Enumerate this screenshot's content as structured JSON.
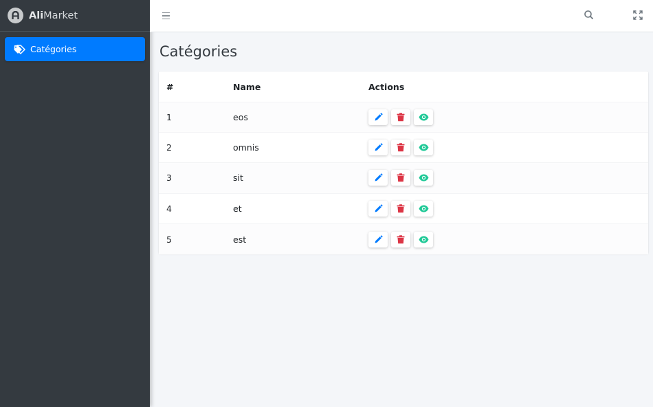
{
  "brand": {
    "name_bold": "Ali",
    "name_rest": "Market"
  },
  "sidebar": {
    "items": [
      {
        "label": "Catégories",
        "icon": "tags-icon",
        "active": true
      }
    ]
  },
  "topbar": {
    "menu_icon": "hamburger-icon",
    "search_icon": "search-icon",
    "fullscreen_icon": "expand-icon"
  },
  "page": {
    "title": "Catégories"
  },
  "table": {
    "headers": [
      "#",
      "Name",
      "Actions"
    ],
    "rows": [
      {
        "id": "1",
        "name": "eos"
      },
      {
        "id": "2",
        "name": "omnis"
      },
      {
        "id": "3",
        "name": "sit"
      },
      {
        "id": "4",
        "name": "et"
      },
      {
        "id": "5",
        "name": "est"
      }
    ],
    "row_actions": [
      {
        "name": "edit",
        "icon": "pencil-icon",
        "color": "#007bff"
      },
      {
        "name": "delete",
        "icon": "trash-icon",
        "color": "#dc3545"
      },
      {
        "name": "view",
        "icon": "eye-icon",
        "color": "#20c997"
      }
    ]
  },
  "colors": {
    "primary": "#007bff",
    "danger": "#dc3545",
    "success": "#20c997",
    "sidebar_bg": "#343a40",
    "content_bg": "#f4f6f9"
  }
}
